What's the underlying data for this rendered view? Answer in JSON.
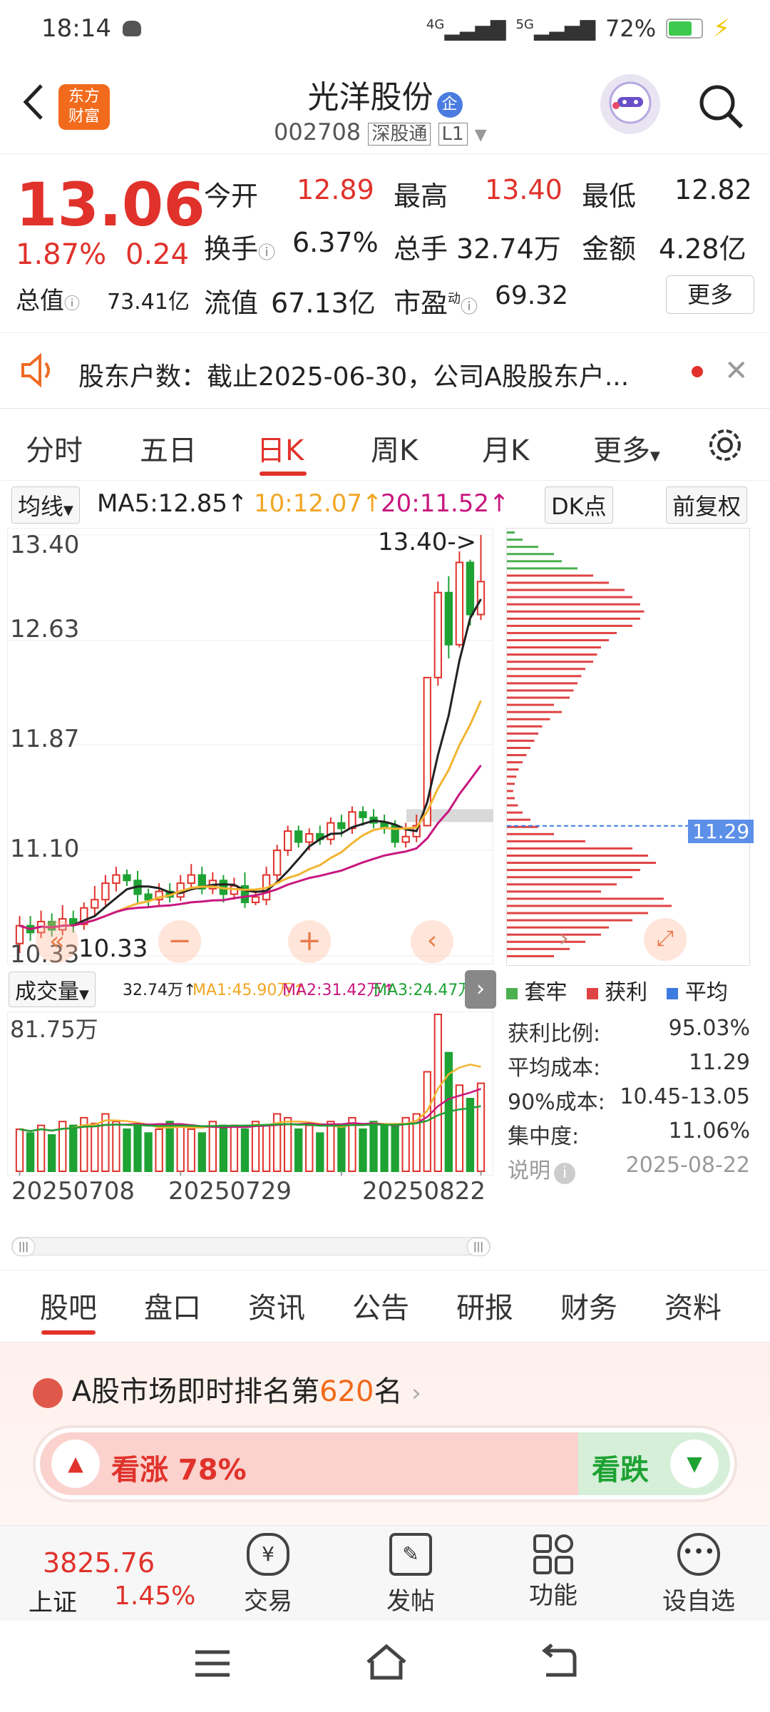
{
  "status_bar": {
    "time": "18:14",
    "battery": "72%",
    "net1": "4G",
    "net2": "5G"
  },
  "header": {
    "logo_line1": "东方",
    "logo_line2": "财富",
    "title": "光洋股份",
    "badge": "企",
    "code": "002708",
    "tag1": "深股通",
    "tag2": "L1"
  },
  "quote": {
    "price": "13.06",
    "change_pct": "1.87%",
    "change": "0.24",
    "rows": [
      [
        {
          "label": "今开",
          "value": "12.89",
          "color": "red"
        },
        {
          "label": "最高",
          "value": "13.40",
          "color": "red"
        },
        {
          "label": "最低",
          "value": "12.82",
          "color": "normal"
        }
      ],
      [
        {
          "label": "换手",
          "value": "6.37%",
          "color": "normal"
        },
        {
          "label": "总手",
          "value": "32.74万",
          "color": "normal"
        },
        {
          "label": "金额",
          "value": "4.28亿",
          "color": "normal"
        }
      ],
      [
        {
          "label": "总值",
          "value": "73.41亿"
        },
        {
          "label": "流值",
          "value": "67.13亿"
        },
        {
          "label": "市盈",
          "value": "69.32"
        }
      ]
    ],
    "pe_sup": "动",
    "more": "更多"
  },
  "notice": {
    "text": "股东户数：截止2025-06-30，公司A股股东户..."
  },
  "tabs": [
    "分时",
    "五日",
    "日K",
    "周K",
    "月K",
    "更多"
  ],
  "active_tab": 2,
  "kline": {
    "ma_label": "均线",
    "ma5": "MA5:12.85↑",
    "ma10": "10:12.07↑",
    "ma20": "20:11.52↑",
    "dk": "DK点",
    "fq": "前复权",
    "y_labels": [
      "13.40",
      "12.63",
      "11.87",
      "11.10",
      "10.33"
    ],
    "high_marker": "13.40->",
    "low_marker": "10.33",
    "cost_line": "11.29"
  },
  "volume": {
    "label": "成交量",
    "v": "32.74万↑",
    "ma1": "MA1:45.90万↑",
    "ma2": "MA2:31.42万↑",
    "ma3": "MA3:24.47万↑",
    "max": "81.75万",
    "dates": [
      "20250708",
      "20250729",
      "20250822"
    ]
  },
  "chip": {
    "legend": [
      "套牢",
      "获利",
      "平均"
    ],
    "stats": [
      {
        "label": "获利比例:",
        "value": "95.03%"
      },
      {
        "label": "平均成本:",
        "value": "11.29"
      },
      {
        "label": "90%成本:",
        "value": "10.45-13.05"
      },
      {
        "label": "集中度:",
        "value": "11.06%"
      }
    ],
    "note": "说明",
    "date": "2025-08-22"
  },
  "bottom_tabs": [
    "股吧",
    "盘口",
    "资讯",
    "公告",
    "研报",
    "财务",
    "资料"
  ],
  "rank": {
    "prefix": "A股市场即时排名第",
    "rank": "620",
    "suffix": "名"
  },
  "vote": {
    "up": "看涨 78%",
    "down": "看跌",
    "up_ratio": 0.78
  },
  "bottom_nav": {
    "index_value": "3825.76",
    "index_name": "上证",
    "index_pct": "1.45%",
    "items": [
      "交易",
      "发帖",
      "功能",
      "设自选"
    ]
  },
  "colors": {
    "up": "#e0322b",
    "down": "#1ea233",
    "ma5": "#222222",
    "ma10": "#f2b531",
    "ma20": "#c8177f"
  },
  "candles": [
    [
      10.42,
      10.55,
      10.62,
      10.35
    ],
    [
      10.55,
      10.5,
      10.62,
      10.44
    ],
    [
      10.5,
      10.58,
      10.66,
      10.46
    ],
    [
      10.58,
      10.52,
      10.64,
      10.47
    ],
    [
      10.52,
      10.6,
      10.7,
      10.48
    ],
    [
      10.6,
      10.56,
      10.66,
      10.5
    ],
    [
      10.56,
      10.68,
      10.72,
      10.52
    ],
    [
      10.68,
      10.74,
      10.84,
      10.62
    ],
    [
      10.74,
      10.86,
      10.92,
      10.7
    ],
    [
      10.86,
      10.92,
      10.98,
      10.8
    ],
    [
      10.92,
      10.88,
      10.96,
      10.84
    ],
    [
      10.88,
      10.78,
      10.95,
      10.72
    ],
    [
      10.78,
      10.74,
      10.82,
      10.68
    ],
    [
      10.74,
      10.8,
      10.86,
      10.7
    ],
    [
      10.8,
      10.76,
      10.86,
      10.72
    ],
    [
      10.76,
      10.86,
      10.92,
      10.73
    ],
    [
      10.86,
      10.92,
      11.0,
      10.82
    ],
    [
      10.92,
      10.82,
      10.98,
      10.78
    ],
    [
      10.82,
      10.88,
      10.94,
      10.78
    ],
    [
      10.88,
      10.78,
      10.92,
      10.72
    ],
    [
      10.78,
      10.84,
      10.9,
      10.74
    ],
    [
      10.84,
      10.72,
      10.94,
      10.68
    ],
    [
      10.72,
      10.76,
      10.82,
      10.7
    ],
    [
      10.74,
      10.92,
      10.98,
      10.7
    ],
    [
      10.92,
      11.1,
      11.14,
      10.88
    ],
    [
      11.1,
      11.24,
      11.28,
      11.06
    ],
    [
      11.24,
      11.16,
      11.28,
      11.12
    ],
    [
      11.16,
      11.22,
      11.26,
      11.1
    ],
    [
      11.22,
      11.18,
      11.28,
      11.14
    ],
    [
      11.18,
      11.3,
      11.34,
      11.14
    ],
    [
      11.3,
      11.26,
      11.36,
      11.2
    ],
    [
      11.26,
      11.38,
      11.42,
      11.22
    ],
    [
      11.38,
      11.34,
      11.42,
      11.28
    ],
    [
      11.34,
      11.3,
      11.4,
      11.26
    ],
    [
      11.3,
      11.26,
      11.36,
      11.22
    ],
    [
      11.28,
      11.16,
      11.32,
      11.12
    ],
    [
      11.16,
      11.2,
      11.3,
      11.12
    ],
    [
      11.2,
      11.28,
      11.36,
      11.16
    ],
    [
      11.28,
      12.36,
      12.36,
      11.28
    ],
    [
      12.36,
      12.98,
      13.06,
      12.3
    ],
    [
      12.98,
      12.6,
      13.1,
      12.5
    ],
    [
      12.6,
      13.2,
      13.28,
      12.58
    ],
    [
      13.2,
      12.82,
      13.22,
      12.74
    ],
    [
      12.82,
      13.06,
      13.4,
      12.78
    ]
  ],
  "vol": [
    22,
    20,
    24,
    19,
    26,
    24,
    28,
    25,
    30,
    26,
    22,
    24,
    20,
    22,
    26,
    24,
    22,
    20,
    26,
    24,
    24,
    22,
    26,
    24,
    30,
    28,
    22,
    24,
    20,
    26,
    24,
    28,
    22,
    26,
    24,
    24,
    28,
    30,
    52,
    82,
    62,
    45,
    38,
    46
  ],
  "chip_bars": []
}
